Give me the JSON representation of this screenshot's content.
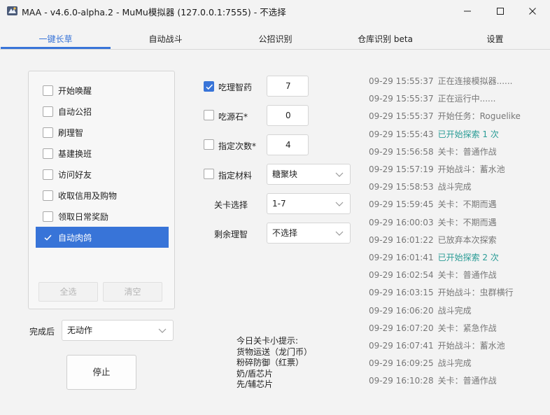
{
  "window": {
    "title": "MAA - v4.6.0-alpha.2 - MuMu模拟器 (127.0.0.1:7555) - 不选择"
  },
  "tabs": [
    {
      "label": "一键长草",
      "active": true
    },
    {
      "label": "自动战斗",
      "active": false
    },
    {
      "label": "公招识别",
      "active": false
    },
    {
      "label": "仓库识别 beta",
      "active": false
    },
    {
      "label": "设置",
      "active": false
    }
  ],
  "tasks": {
    "items": [
      {
        "label": "开始唤醒",
        "checked": false
      },
      {
        "label": "自动公招",
        "checked": false
      },
      {
        "label": "刷理智",
        "checked": false
      },
      {
        "label": "基建换班",
        "checked": false
      },
      {
        "label": "访问好友",
        "checked": false
      },
      {
        "label": "收取信用及购物",
        "checked": false
      },
      {
        "label": "领取日常奖励",
        "checked": false
      },
      {
        "label": "自动肉鸽",
        "checked": true
      }
    ],
    "select_all_label": "全选",
    "clear_label": "清空"
  },
  "after_completion": {
    "label": "完成后",
    "value": "无动作"
  },
  "stop_button_label": "停止",
  "settings": {
    "medicine": {
      "label": "吃理智药",
      "checked": true,
      "value": "7"
    },
    "stone": {
      "label": "吃源石*",
      "checked": false,
      "value": "0"
    },
    "times": {
      "label": "指定次数*",
      "checked": false,
      "value": "4"
    },
    "material": {
      "label": "指定材料",
      "checked": false,
      "value": "糖聚块"
    },
    "stage": {
      "label": "关卡选择",
      "value": "1-7"
    },
    "remaining": {
      "label": "剩余理智",
      "value": "不选择"
    }
  },
  "tips": {
    "title": "今日关卡小提示:",
    "lines": [
      "货物运送（龙门币）",
      "粉碎防御（红票）",
      "奶/盾芯片",
      "先/辅芯片"
    ]
  },
  "log": [
    {
      "time": "09-29  15:55:37",
      "message": "正在连接模拟器......",
      "color": "#777777"
    },
    {
      "time": "09-29  15:55:37",
      "message": "正在运行中......",
      "color": "#777777"
    },
    {
      "time": "09-29  15:55:37",
      "message": "开始任务：Roguelike",
      "color": "#777777"
    },
    {
      "time": "09-29  15:55:43",
      "message": "已开始探索 1 次",
      "color": "#2a9c96"
    },
    {
      "time": "09-29  15:56:58",
      "message": "关卡：普通作战",
      "color": "#777777"
    },
    {
      "time": "09-29  15:57:19",
      "message": "开始战斗：蓄水池",
      "color": "#777777"
    },
    {
      "time": "09-29  15:58:53",
      "message": "战斗完成",
      "color": "#777777"
    },
    {
      "time": "09-29  15:59:45",
      "message": "关卡：不期而遇",
      "color": "#777777"
    },
    {
      "time": "09-29  16:00:03",
      "message": "关卡：不期而遇",
      "color": "#777777"
    },
    {
      "time": "09-29  16:01:22",
      "message": "已放弃本次探索",
      "color": "#777777"
    },
    {
      "time": "09-29  16:01:41",
      "message": "已开始探索 2 次",
      "color": "#2a9c96"
    },
    {
      "time": "09-29  16:02:54",
      "message": "关卡：普通作战",
      "color": "#777777"
    },
    {
      "time": "09-29  16:03:15",
      "message": "开始战斗：虫群横行",
      "color": "#777777"
    },
    {
      "time": "09-29  16:06:20",
      "message": "战斗完成",
      "color": "#777777"
    },
    {
      "time": "09-29  16:07:20",
      "message": "关卡：紧急作战",
      "color": "#777777"
    },
    {
      "time": "09-29  16:07:41",
      "message": "开始战斗：蓄水池",
      "color": "#777777"
    },
    {
      "time": "09-29  16:09:25",
      "message": "战斗完成",
      "color": "#777777"
    },
    {
      "time": "09-29  16:10:28",
      "message": "关卡：普通作战",
      "color": "#777777"
    }
  ],
  "colors": {
    "accent": "#3874d8",
    "log_highlight": "#2a9c96"
  }
}
